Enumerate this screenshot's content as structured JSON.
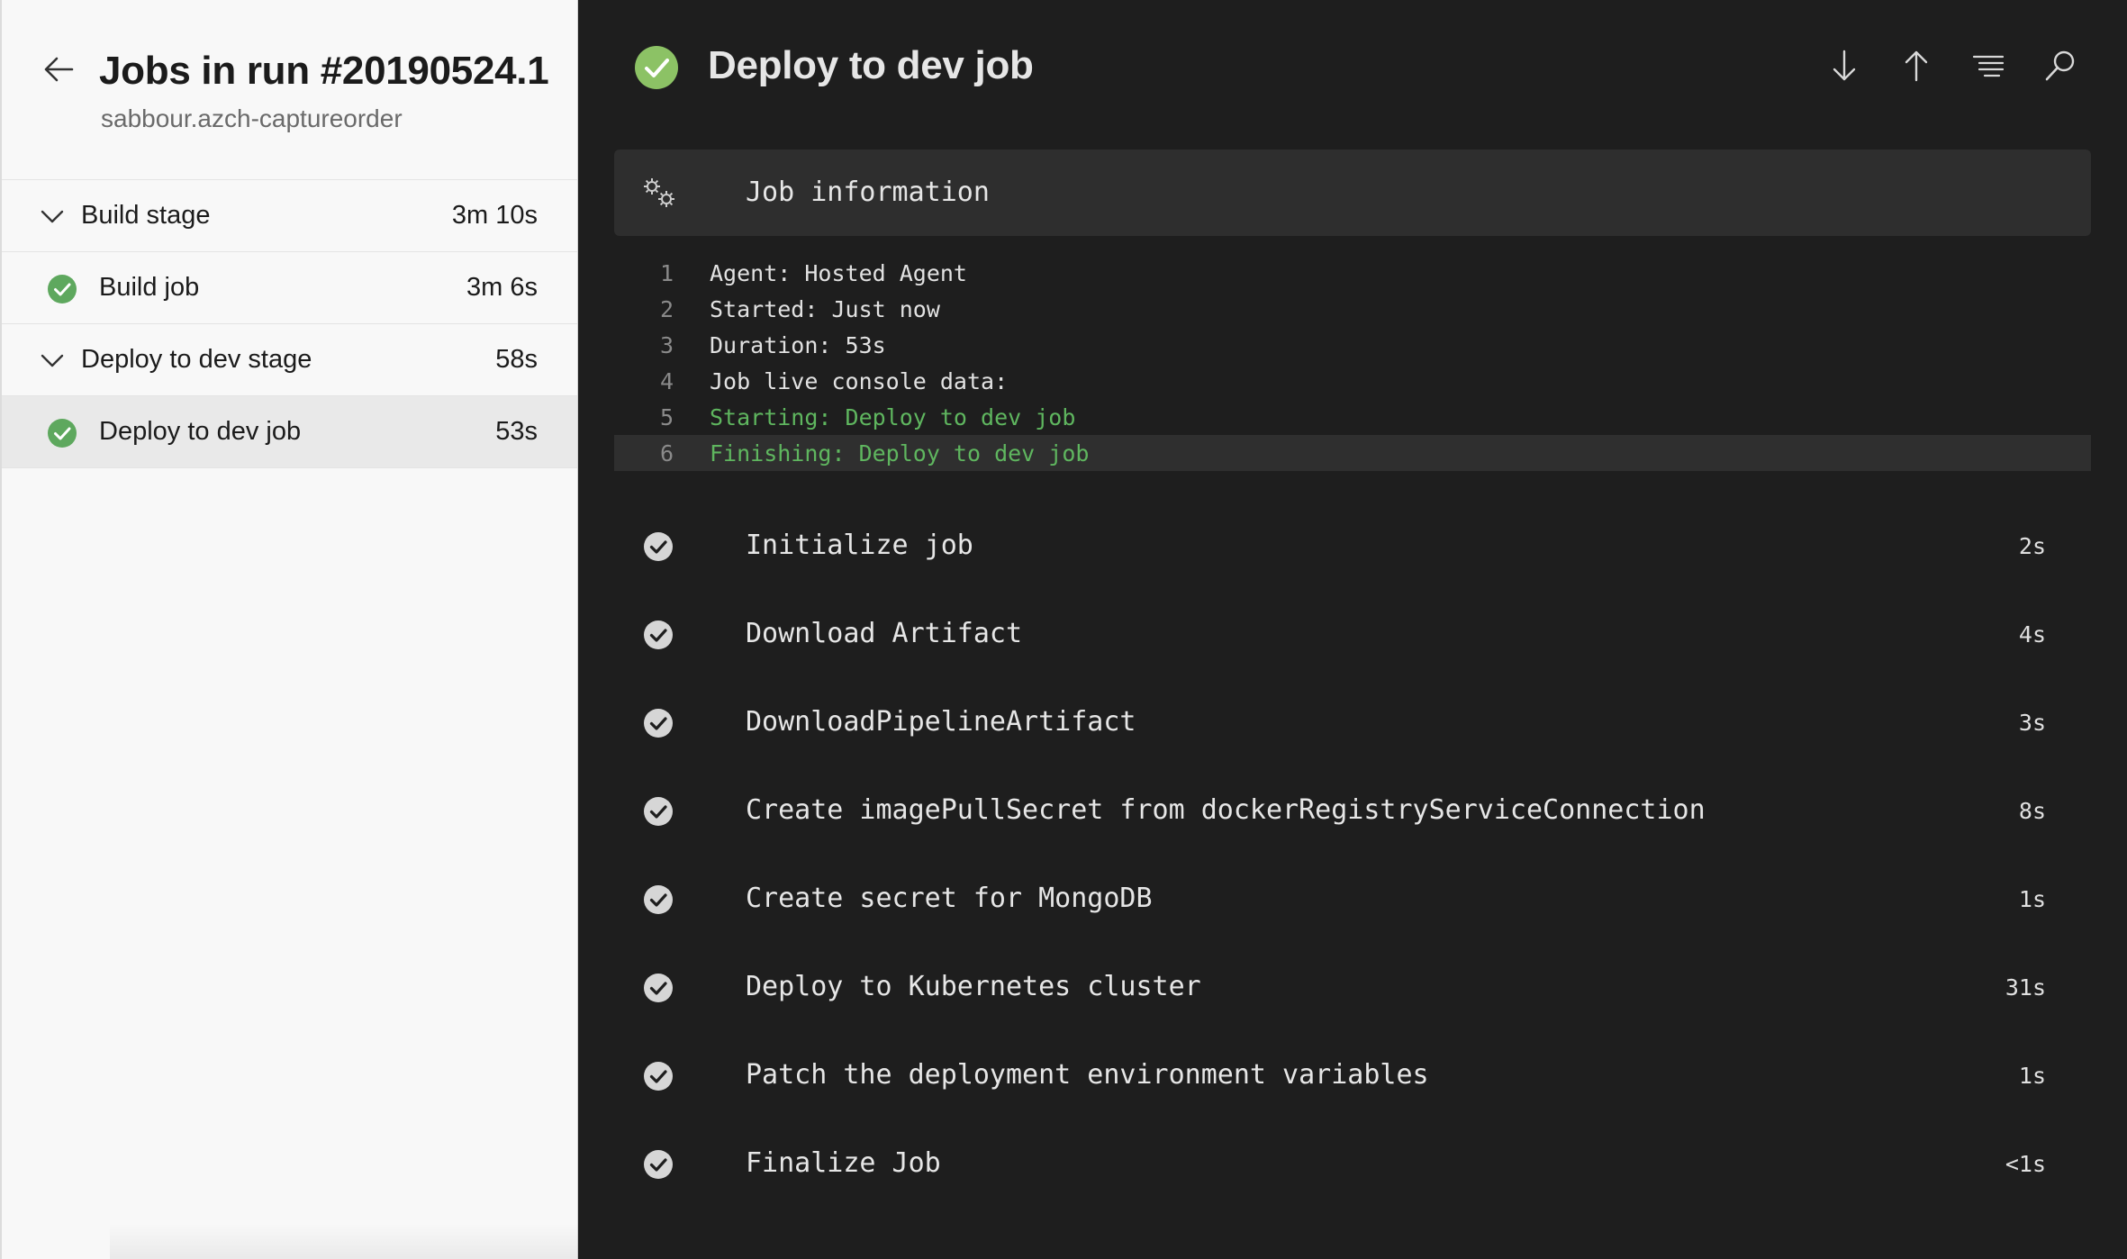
{
  "left": {
    "title": "Jobs in run #20190524.1",
    "subtitle": "sabbour.azch-captureorder",
    "rows": [
      {
        "type": "stage",
        "label": "Build stage",
        "duration": "3m 10s"
      },
      {
        "type": "job",
        "label": "Build job",
        "duration": "3m 6s",
        "status": "succeeded"
      },
      {
        "type": "stage",
        "label": "Deploy to dev stage",
        "duration": "58s"
      },
      {
        "type": "job",
        "label": "Deploy to dev job",
        "duration": "53s",
        "status": "succeeded",
        "selected": true
      }
    ]
  },
  "header": {
    "title": "Deploy to dev job",
    "status": "succeeded",
    "tools": [
      "arrow-down-icon",
      "arrow-up-icon",
      "wrap-lines-icon",
      "search-icon"
    ]
  },
  "job_info": {
    "title": "Job information",
    "lines": [
      {
        "num": "1",
        "text": "Agent: Hosted Agent"
      },
      {
        "num": "2",
        "text": "Started: Just now"
      },
      {
        "num": "3",
        "text": "Duration: 53s"
      },
      {
        "num": "4",
        "text": "Job live console data:"
      },
      {
        "num": "5",
        "text": "Starting: Deploy to dev job"
      },
      {
        "num": "6",
        "text": "Finishing: Deploy to dev job"
      }
    ]
  },
  "steps": [
    {
      "name": "Initialize job",
      "duration": "2s"
    },
    {
      "name": "Download Artifact",
      "duration": "4s"
    },
    {
      "name": "DownloadPipelineArtifact",
      "duration": "3s"
    },
    {
      "name": "Create imagePullSecret from dockerRegistryServiceConnection",
      "duration": "8s"
    },
    {
      "name": "Create secret for MongoDB",
      "duration": "1s"
    },
    {
      "name": "Deploy to Kubernetes cluster",
      "duration": "31s"
    },
    {
      "name": "Patch the deployment environment variables",
      "duration": "1s"
    },
    {
      "name": "Finalize Job",
      "duration": "<1s"
    }
  ],
  "colors": {
    "success_green": "#5ea85e",
    "log_green": "#5fb65f",
    "dark_bg": "#1e1e1e",
    "panel_bg": "#f8f8f8"
  }
}
